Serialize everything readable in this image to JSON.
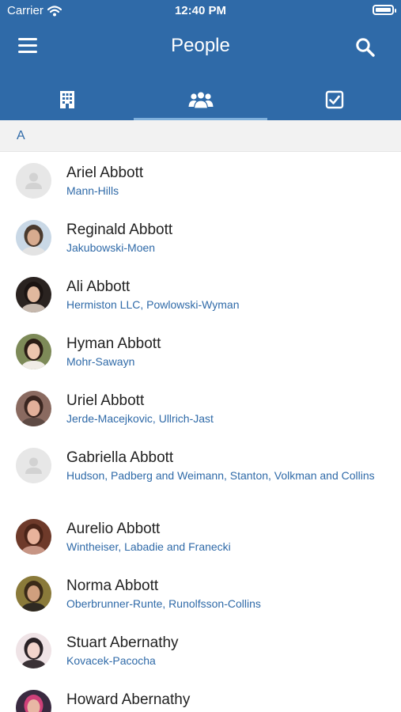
{
  "status_bar": {
    "carrier": "Carrier",
    "time": "12:40 PM"
  },
  "header": {
    "title": "People"
  },
  "tabs": [
    {
      "label": "Companies",
      "icon": "building-icon",
      "active": false
    },
    {
      "label": "People",
      "icon": "people-icon",
      "active": true
    },
    {
      "label": "Tasks",
      "icon": "checkbox-icon",
      "active": false
    }
  ],
  "section": {
    "letter": "A"
  },
  "contacts": [
    {
      "name": "Ariel Abbott",
      "company": "Mann-Hills",
      "avatar": "placeholder",
      "colors": {
        "bg": "#e7e7e7"
      }
    },
    {
      "name": "Reginald Abbott",
      "company": "Jakubowski-Moen",
      "avatar": "photo",
      "colors": {
        "bg": "#c9d8e6",
        "hair": "#4a3a2e",
        "skin": "#d7ab8f",
        "shirt": "#e3e3e3"
      }
    },
    {
      "name": "Ali Abbott",
      "company": "Hermiston LLC, Powlowski-Wyman",
      "avatar": "photo",
      "colors": {
        "bg": "#2a2320",
        "hair": "#1b1412",
        "skin": "#e0b89e",
        "shirt": "#c6b8ad"
      }
    },
    {
      "name": "Hyman Abbott",
      "company": "Mohr-Sawayn",
      "avatar": "photo",
      "colors": {
        "bg": "#7d8a58",
        "hair": "#2a1d15",
        "skin": "#ecc6ae",
        "shirt": "#f0ece6"
      }
    },
    {
      "name": "Uriel Abbott",
      "company": "Jerde-Macejkovic, Ullrich-Jast",
      "avatar": "photo",
      "colors": {
        "bg": "#8a6a60",
        "hair": "#3a2620",
        "skin": "#e2b09a",
        "shirt": "#5e4a44"
      }
    },
    {
      "name": "Gabriella Abbott",
      "company": "Hudson, Padberg and Weimann, Stanton, Volkman and Collins",
      "avatar": "placeholder",
      "colors": {
        "bg": "#e7e7e7"
      }
    },
    {
      "name": "Aurelio Abbott",
      "company": "Wintheiser, Labadie and Franecki",
      "avatar": "photo",
      "colors": {
        "bg": "#6e3a2a",
        "hair": "#4a2418",
        "skin": "#e8b39c",
        "shirt": "#c79584"
      }
    },
    {
      "name": "Norma Abbott",
      "company": "Oberbrunner-Runte, Runolfsson-Collins",
      "avatar": "photo",
      "colors": {
        "bg": "#8a7a3a",
        "hair": "#3a2a18",
        "skin": "#cf9f7e",
        "shirt": "#2f2a22"
      }
    },
    {
      "name": "Stuart Abernathy",
      "company": "Kovacek-Pacocha",
      "avatar": "photo",
      "colors": {
        "bg": "#efe3e6",
        "hair": "#2a2226",
        "skin": "#f2d4cc",
        "shirt": "#3a3236"
      }
    },
    {
      "name": "Howard Abernathy",
      "company": "",
      "avatar": "photo",
      "colors": {
        "bg": "#3a2a40",
        "hair": "#d0407a",
        "skin": "#e8b7a4",
        "shirt": "#4a3a54"
      }
    }
  ]
}
